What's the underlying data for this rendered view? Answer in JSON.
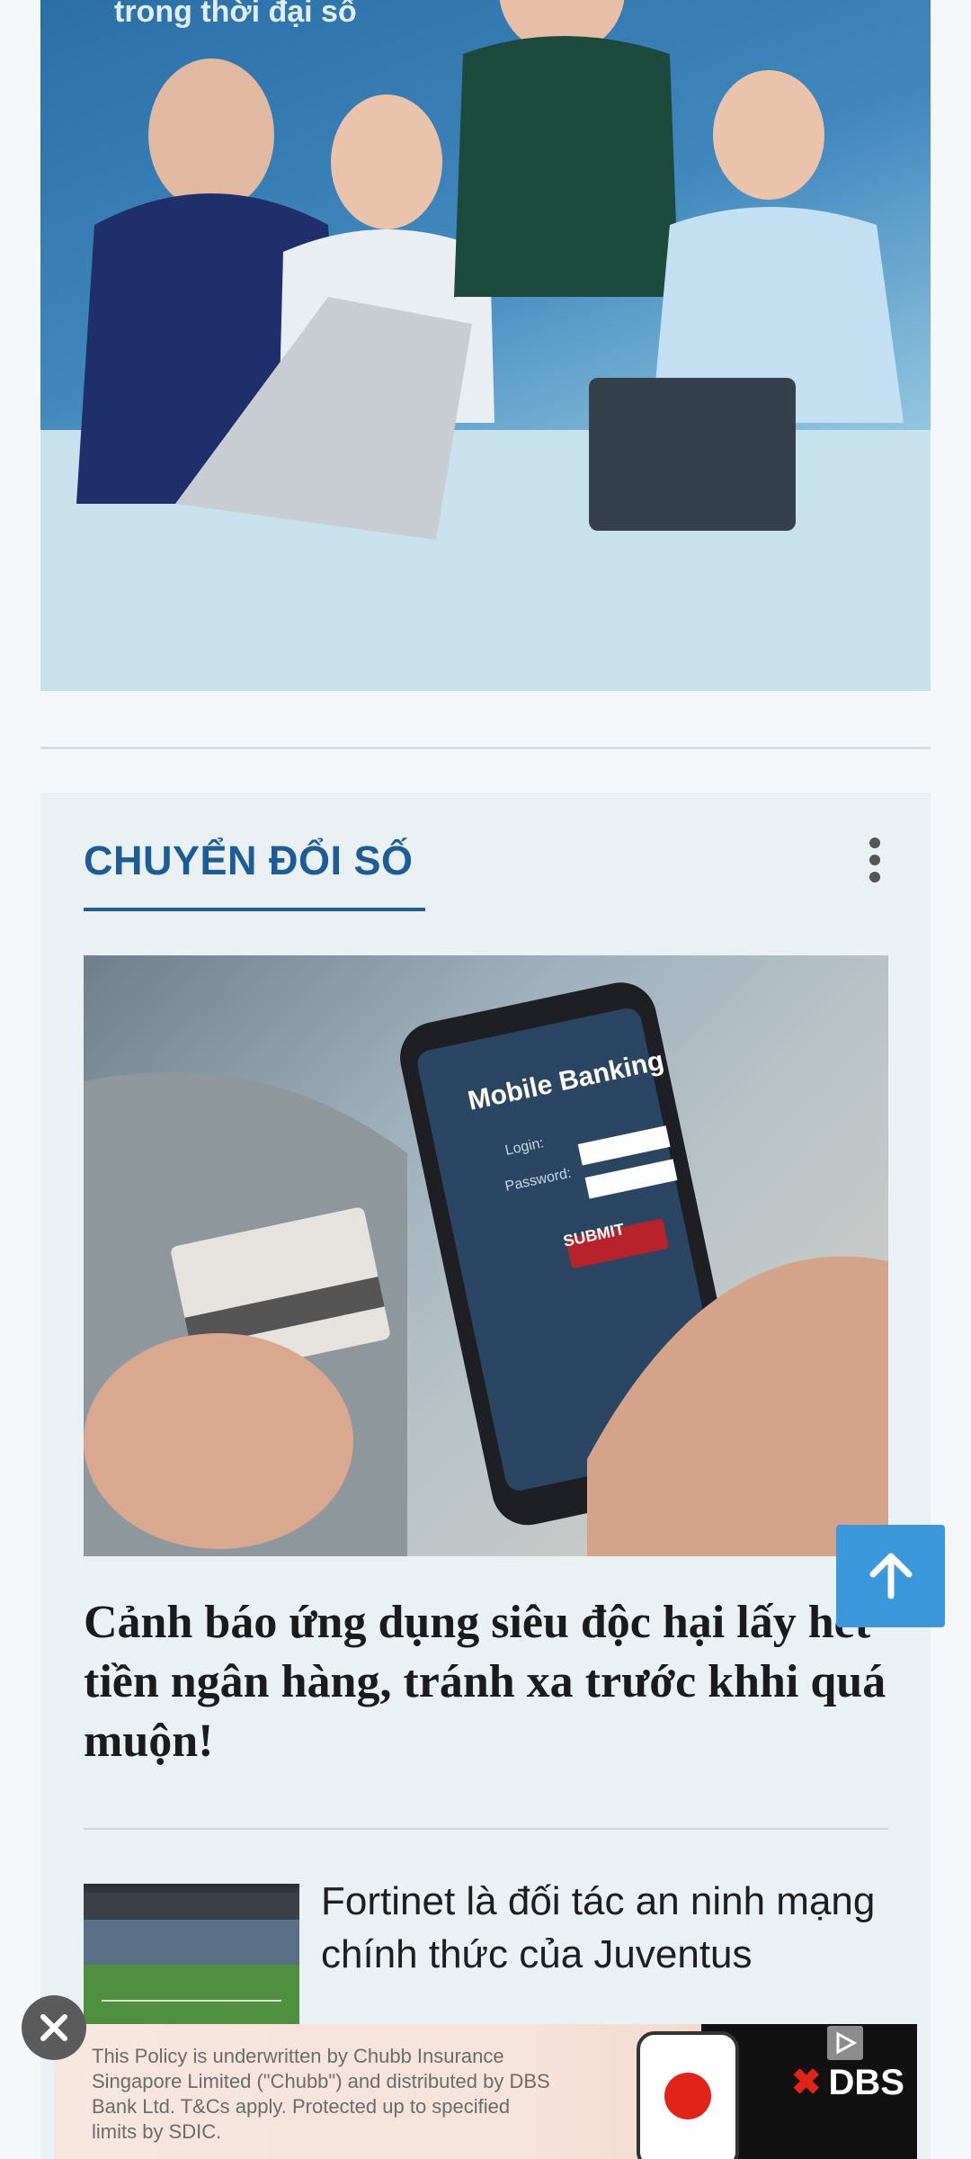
{
  "hero": {
    "caption": "trong thời đại số"
  },
  "section": {
    "title": "CHUYỂN ĐỔI SỐ",
    "featured": {
      "image_text": {
        "app_name": "Mobile Banking",
        "login_label": "Login:",
        "password_label": "Password:",
        "submit_label": "SUBMIT"
      },
      "title": "Cảnh báo ứng dụng siêu độc hại lấy hết tiền ngân hàng, tránh xa trước khhi quá muộn!"
    },
    "items": [
      {
        "title": "Fortinet là đối tác an ninh mạng chính thức của Juventus"
      }
    ]
  },
  "controls": {
    "back_to_top_icon": "arrow-up-icon",
    "ad_close_icon": "close-icon",
    "more_icon": "vertical-dots-icon"
  },
  "ad": {
    "text": "This Policy is underwritten by Chubb Insurance Singapore Limited (\"Chubb\") and distributed by DBS Bank Ltd. T&Cs apply. Protected up to specified limits by SDIC.",
    "brand": "DBS"
  },
  "colors": {
    "accent": "#1d5d97",
    "back_to_top": "#3a98db",
    "background": "#f4f8fb",
    "section_bg": "#eaf1f5"
  }
}
